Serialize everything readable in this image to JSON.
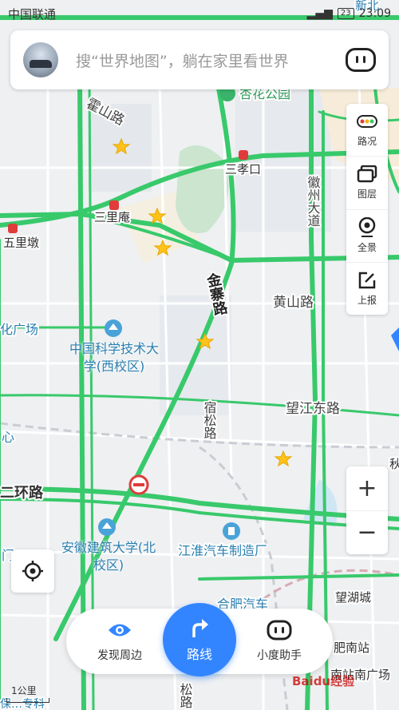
{
  "status_bar": {
    "carrier": "中国联通",
    "battery": "23",
    "time": "23:09"
  },
  "search": {
    "placeholder": "搜“世界地图”，躺在家里看世界"
  },
  "map_labels": {
    "huoshan_rd": "霍山路",
    "xinghua_park": "杏花公园",
    "xinbei": "新北",
    "sanxiaokou": "三孝口",
    "huizhou_ave": "徽州大道",
    "sanlian": "三里庵",
    "wuliduan": "五里墩",
    "jinzhai_rd": "金寨路",
    "huangshan_rd": "黄山路",
    "hua_square": "化广场",
    "ustc_west": "中国科学技术大学(西校区)",
    "susong_rd": "宿松路",
    "wangjiang_e_rd": "望江东路",
    "xin": "心",
    "qiu": "秋",
    "second_ring": "二环路",
    "ahjzu_north": "安徽建筑大学(北校区)",
    "jac_plant": "江淮汽车制造厂",
    "men": "门",
    "wanghucheng": "望湖城",
    "hefei_auto": "合肥汽车",
    "feinan_station": "肥南站",
    "nanzhan_square": "南站南广场",
    "susong_rd_2": "松路",
    "baomei": "保…专科"
  },
  "right_panel": [
    {
      "label": "路况",
      "icon": "traffic-icon"
    },
    {
      "label": "图层",
      "icon": "layers-icon"
    },
    {
      "label": "全景",
      "icon": "panorama-icon"
    },
    {
      "label": "上报",
      "icon": "report-icon"
    }
  ],
  "zoom": {
    "in": "+",
    "out": "−"
  },
  "bottom_bar": {
    "discover": "发现周边",
    "route": "路线",
    "assistant": "小度助手"
  },
  "scale": {
    "label": "1公里"
  },
  "watermark": "Baidu经验",
  "colors": {
    "road_green": "#38c96b",
    "route_blue": "#3385ff",
    "label_blue": "#2a7fb0",
    "poi_star": "#ffc21b",
    "rail_red": "#e03c3c"
  }
}
